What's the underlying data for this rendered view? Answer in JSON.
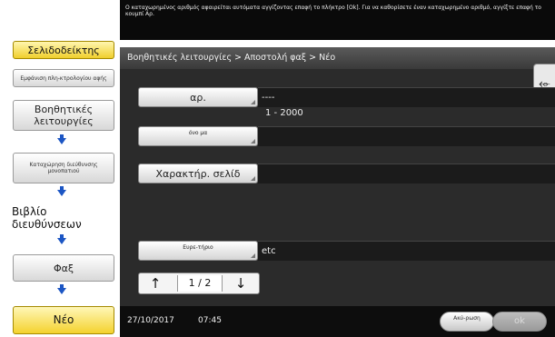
{
  "top_message": "Ο καταχωρημένος αριθμός αφαιρείται αυτόματα αγγίζοντας επαφή το πλήκτρο [Ok]. Για να καθορίσετε έναν καταχωρημένο αριθμό, αγγίξτε επαφή το κουμπί Αρ.",
  "sidebar": {
    "bookmark_tab": "Σελιδοδείκτης",
    "items": [
      {
        "label": "Εμφάνιση πλη-κτρολογίου αφής"
      },
      {
        "label": "Βοηθητικές λειτουργίες"
      },
      {
        "label": "Καταχώρηση διεύθυνσης μονοπατιού"
      },
      {
        "label": "Βιβλίο διευθύνσεων"
      },
      {
        "label": "Φαξ"
      },
      {
        "label": "Νέο"
      }
    ]
  },
  "breadcrumb": "Βοηθητικές λειτουργίες > Αποστολή φαξ > Νέο",
  "fields": {
    "number": {
      "label": "αρ.",
      "value": "----",
      "range": "1 - 2000"
    },
    "name": {
      "label": "όνο μα",
      "value": ""
    },
    "index_char": {
      "label": "Χαρακτήρ. σελίδ",
      "value": ""
    },
    "index": {
      "label": "Ευρε-τήριο",
      "value": "etc"
    }
  },
  "pager": {
    "up": "↑",
    "page": "1 / 2",
    "down": "↓"
  },
  "bottom": {
    "date": "27/10/2017",
    "time": "07:45",
    "cancel_label": "Ακύ-ρωση",
    "ok_label": "ok"
  },
  "colors": {
    "accent_yellow": "#f4d22e",
    "arrow_blue": "#1c56c4",
    "panel_dark": "#2b2b2b"
  }
}
